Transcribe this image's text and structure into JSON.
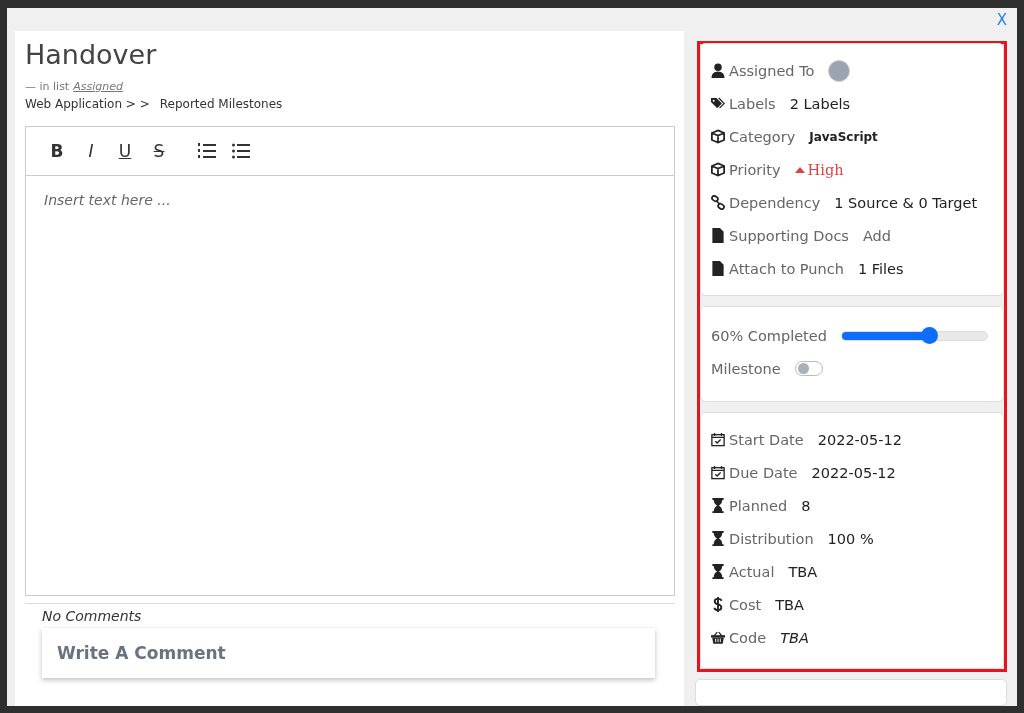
{
  "close": "X",
  "title": "Handover",
  "list_line": {
    "prefix": "—  in list",
    "link": "Assigned"
  },
  "breadcrumb": [
    "Web Application > >",
    "Reported Milestones"
  ],
  "toolbar": [
    "B",
    "I",
    "U",
    "S"
  ],
  "editor": {
    "placeholder": "Insert text here ..."
  },
  "comments": "No Comments",
  "comment_field": {
    "placeholder": "Write A Comment"
  },
  "details": [
    {
      "label": "Assigned To",
      "kind": "avatar"
    },
    {
      "label": "Labels",
      "value": "2 Labels",
      "kind": "text"
    },
    {
      "label": "Category",
      "value": "JavaScript",
      "kind": "bold"
    },
    {
      "label": "Priority",
      "value": "High",
      "kind": "priority"
    },
    {
      "label": "Dependency",
      "value": "1 Source & 0 Target",
      "kind": "text"
    },
    {
      "label": "Supporting Docs",
      "value": "Add",
      "kind": "link"
    },
    {
      "label": "Attach to Punch",
      "value": "1 Files",
      "kind": "text"
    }
  ],
  "progress": {
    "label": "60% Completed",
    "level": 0.6
  },
  "milestone": {
    "label": "Milestone",
    "on": false
  },
  "dates": [
    {
      "label": "Start Date",
      "value": "2022-05-12",
      "kind": "text"
    },
    {
      "label": "Due Date",
      "value": "2022-05-12",
      "kind": "text"
    },
    {
      "label": "Planned",
      "value": "8",
      "kind": "text"
    },
    {
      "label": "Distribution",
      "value": "100 %",
      "kind": "text"
    },
    {
      "label": "Actual",
      "value": "TBA",
      "kind": "text"
    },
    {
      "label": "Cost",
      "value": "TBA",
      "kind": "text"
    },
    {
      "label": "Code",
      "value": "TBA",
      "kind": "italic"
    }
  ]
}
